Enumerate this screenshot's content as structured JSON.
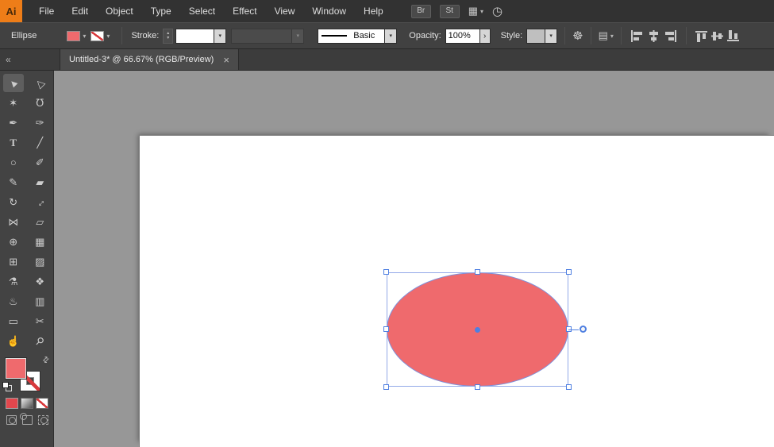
{
  "glyphs": {
    "caret": "▾",
    "spinner_up": "▴",
    "spinner_down": "▾",
    "collapse": "«",
    "swap": "⇄",
    "opacity_arrow": "›"
  },
  "menubar": {
    "logo": "Ai",
    "menus": [
      "File",
      "Edit",
      "Object",
      "Type",
      "Select",
      "Effect",
      "View",
      "Window",
      "Help"
    ],
    "bridge": "Br",
    "stock": "St",
    "arrange_documents_icon": "▦",
    "workspace_icon": "◷"
  },
  "controlbar": {
    "context_label": "Ellipse",
    "fill_color": "#EF6A6D",
    "stroke_color": "none",
    "stroke_label": "Stroke:",
    "stroke_weight_value": "",
    "variable_width_profile_value": "",
    "brush_definition": "Basic",
    "opacity_label": "Opacity:",
    "opacity_value": "100%",
    "style_label": "Style:",
    "recolor_artwork_icon": "☸",
    "align_to_icon": "▤",
    "align_icons": [
      "horizontal-align-left",
      "horizontal-align-center",
      "horizontal-align-right",
      "vertical-align-top",
      "vertical-align-center",
      "vertical-align-bottom"
    ]
  },
  "tab": {
    "title": "Untitled-3* @ 66.67% (RGB/Preview)",
    "close": "×"
  },
  "toolbar": {
    "tools": [
      {
        "name": "selection-tool",
        "glyph": "▲"
      },
      {
        "name": "direct-selection-tool",
        "glyph": "△"
      },
      {
        "name": "magic-wand-tool",
        "glyph": "✶"
      },
      {
        "name": "lasso-tool",
        "glyph": "℧"
      },
      {
        "name": "pen-tool",
        "glyph": "✒"
      },
      {
        "name": "curvature-tool",
        "glyph": "✑"
      },
      {
        "name": "type-tool",
        "glyph": "T"
      },
      {
        "name": "line-segment-tool",
        "glyph": "╱"
      },
      {
        "name": "ellipse-tool",
        "glyph": "○"
      },
      {
        "name": "paintbrush-tool",
        "glyph": "✐"
      },
      {
        "name": "pencil-tool",
        "glyph": "✎"
      },
      {
        "name": "eraser-tool",
        "glyph": "▰"
      },
      {
        "name": "rotate-tool",
        "glyph": "↻"
      },
      {
        "name": "scale-tool",
        "glyph": "↔"
      },
      {
        "name": "width-tool",
        "glyph": "⋈"
      },
      {
        "name": "free-transform-tool",
        "glyph": "▱"
      },
      {
        "name": "shape-builder-tool",
        "glyph": "⊕"
      },
      {
        "name": "perspective-grid-tool",
        "glyph": "▦"
      },
      {
        "name": "mesh-tool",
        "glyph": "⊞"
      },
      {
        "name": "gradient-tool",
        "glyph": "▨"
      },
      {
        "name": "eyedropper-tool",
        "glyph": "⚗"
      },
      {
        "name": "blend-tool",
        "glyph": "❖"
      },
      {
        "name": "symbol-sprayer-tool",
        "glyph": "♨"
      },
      {
        "name": "column-graph-tool",
        "glyph": "▥"
      },
      {
        "name": "artboard-tool",
        "glyph": "▭"
      },
      {
        "name": "slice-tool",
        "glyph": "✂"
      },
      {
        "name": "hand-tool",
        "glyph": "☝"
      },
      {
        "name": "zoom-tool",
        "glyph": "⚲"
      }
    ],
    "drawing_modes": [
      "draw-normal",
      "draw-behind",
      "draw-inside"
    ]
  },
  "colors": {
    "ellipse_fill": "#EF6A6D",
    "selection_blue": "#4E7FE1",
    "canvas_gray": "#979797",
    "artboard_white": "#FFFFFF",
    "ui_dark": "#414141",
    "logo_orange": "#EE7D18"
  }
}
